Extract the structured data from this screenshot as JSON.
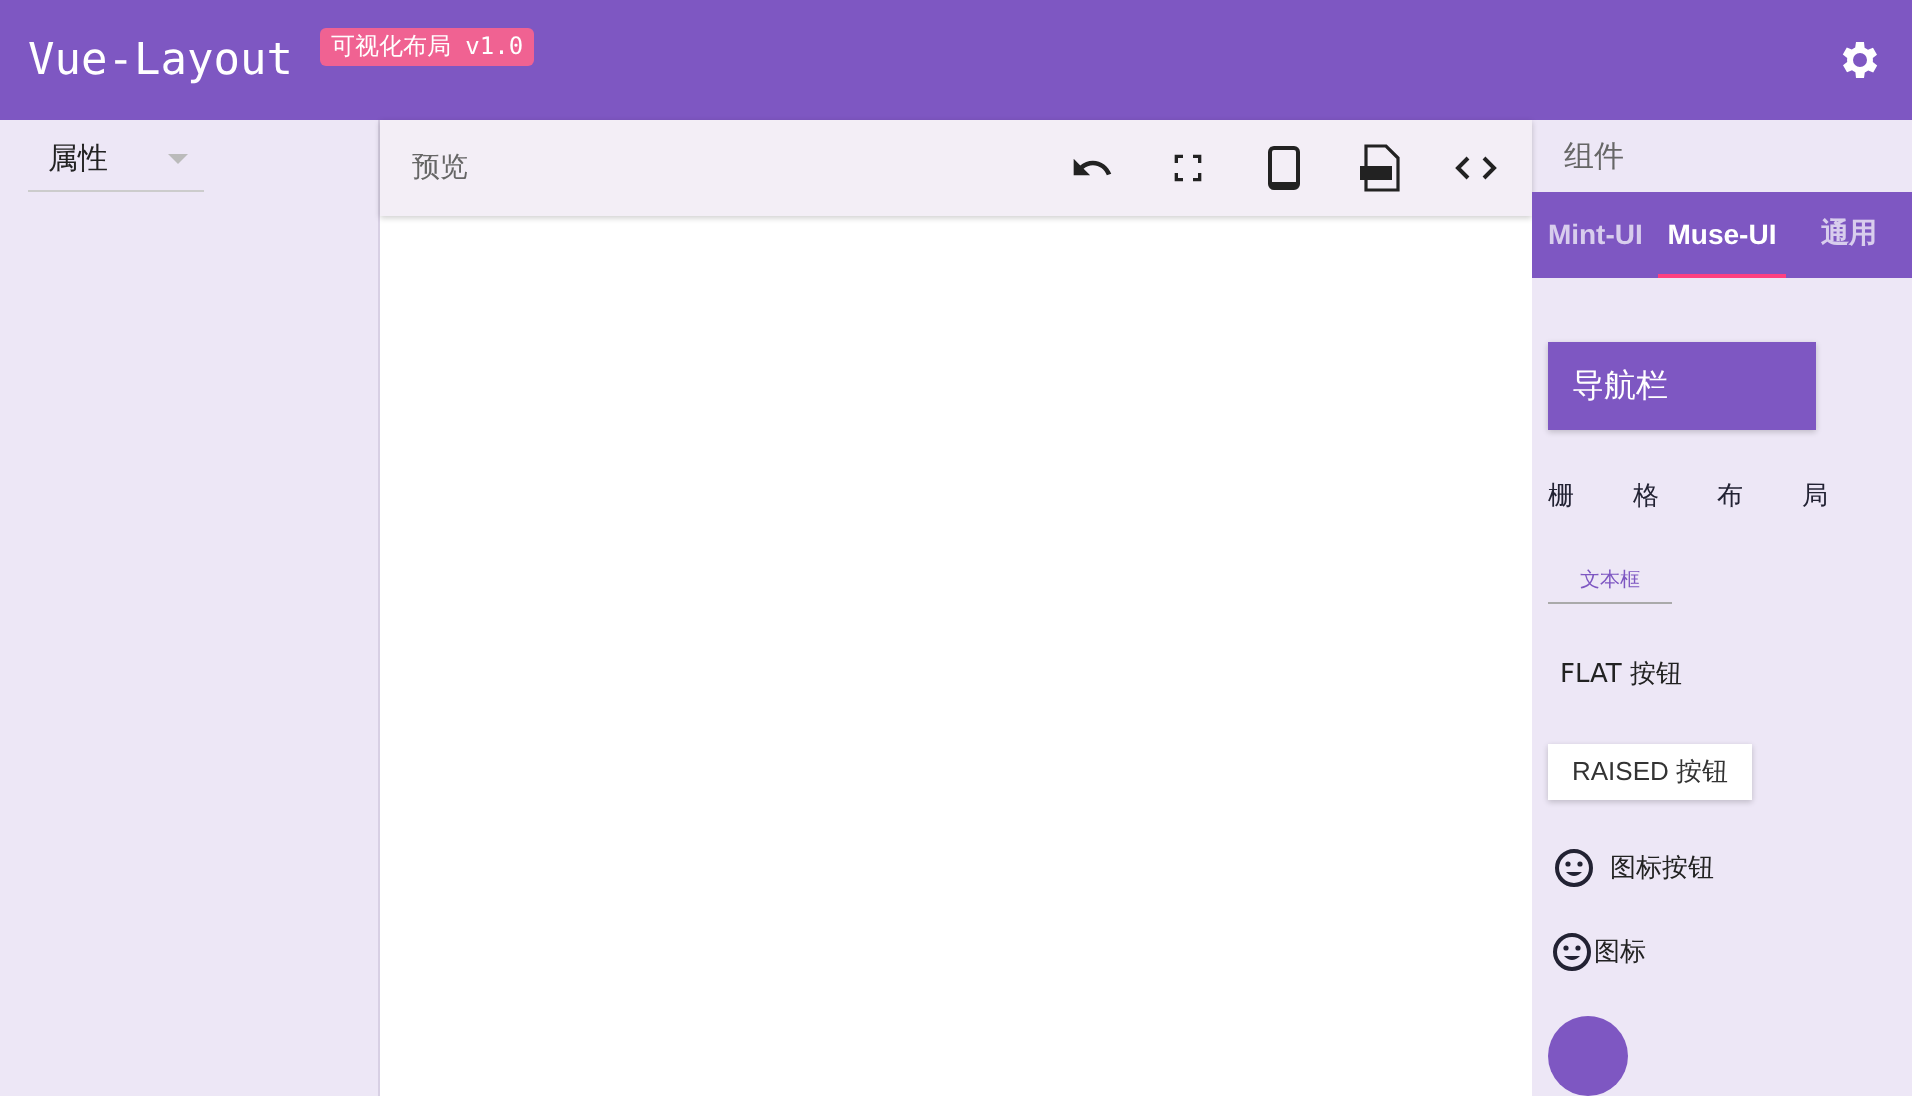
{
  "header": {
    "title": "Vue-Layout",
    "badge": "可视化布局 v1.0"
  },
  "properties": {
    "select_label": "属性"
  },
  "preview": {
    "title": "预览"
  },
  "components": {
    "title": "组件",
    "tabs": [
      {
        "label": "Mint-UI",
        "selected": false
      },
      {
        "label": "Muse-UI",
        "selected": true
      },
      {
        "label": "通用",
        "selected": false
      }
    ],
    "items": [
      {
        "kind": "navbar",
        "label": "导航栏"
      },
      {
        "kind": "grid",
        "cells": [
          "栅",
          "格",
          "布",
          "局"
        ]
      },
      {
        "kind": "textfield",
        "label": "文本框"
      },
      {
        "kind": "flat",
        "label": "FLAT 按钮"
      },
      {
        "kind": "raised",
        "label": "RAISED 按钮"
      },
      {
        "kind": "iconbutton",
        "label": "图标按钮"
      },
      {
        "kind": "icon",
        "label": "图标"
      },
      {
        "kind": "fab"
      }
    ]
  }
}
